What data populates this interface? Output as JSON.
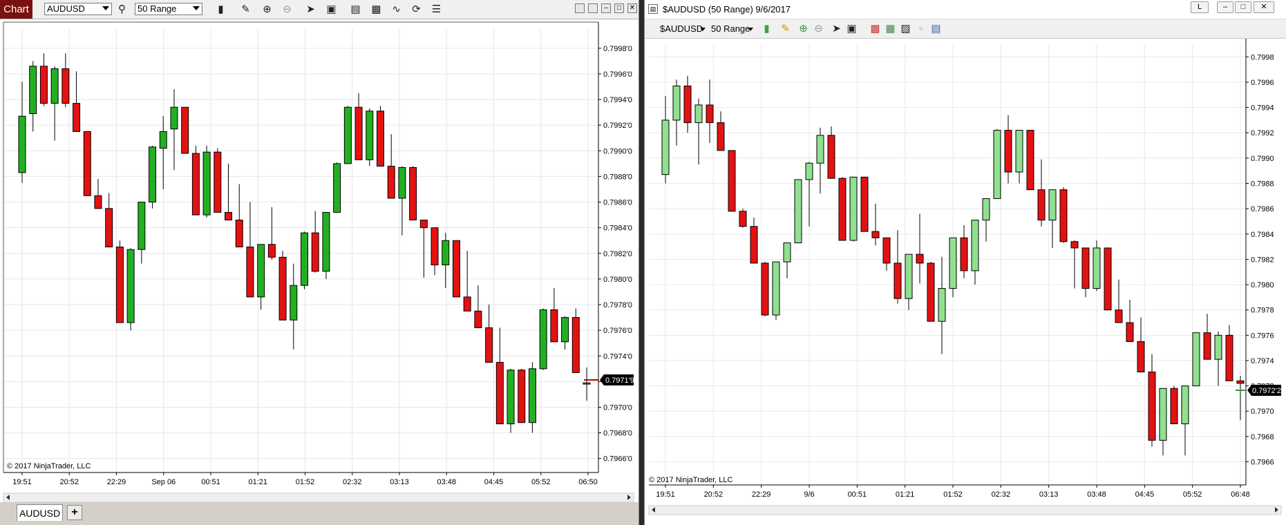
{
  "left": {
    "chart_tab": "Chart",
    "instrument": "AUDUSD",
    "interval": "50 Range",
    "copyright": "© 2017 NinjaTrader, LLC",
    "tab_label": "AUDUSD",
    "add_tab": "+",
    "price_marker": "0.7971'9",
    "y_ticks": [
      "0.7998'0",
      "0.7996'0",
      "0.7994'0",
      "0.7992'0",
      "0.7990'0",
      "0.7988'0",
      "0.7986'0",
      "0.7984'0",
      "0.7982'0",
      "0.7980'0",
      "0.7978'0",
      "0.7976'0",
      "0.7974'0",
      "0.7972'0",
      "0.7970'0",
      "0.7968'0",
      "0.7966'0"
    ],
    "x_ticks": [
      "19:51",
      "20:52",
      "22:29",
      "Sep 06",
      "00:51",
      "01:21",
      "01:52",
      "02:32",
      "03:13",
      "03:48",
      "04:45",
      "05:52",
      "06:50"
    ],
    "colors": {
      "up": "#22b022",
      "down": "#e31212",
      "grid": "#e6e6e6"
    }
  },
  "right": {
    "title": "$AUDUSD (50 Range)  9/6/2017",
    "window_button_l": "L",
    "instrument": "$AUDUSD",
    "interval": "50 Range",
    "copyright": "© 2017 NinjaTrader, LLC",
    "price_marker": "0.7972'2",
    "y_ticks": [
      "0.7998",
      "0.7996",
      "0.7994",
      "0.7992",
      "0.7990",
      "0.7988",
      "0.7986",
      "0.7984",
      "0.7982",
      "0.7980",
      "0.7978",
      "0.7976",
      "0.7974",
      "0.7972",
      "0.7970",
      "0.7968",
      "0.7966"
    ],
    "x_ticks": [
      "19:51",
      "20:52",
      "22:29",
      "9/6",
      "00:51",
      "01:21",
      "01:52",
      "02:32",
      "03:13",
      "03:48",
      "04:45",
      "05:52",
      "06:48"
    ],
    "colors": {
      "up": "#90e090",
      "down": "#e31212",
      "grid": "#e8e8e8"
    }
  },
  "chart_data": [
    {
      "type": "candlestick",
      "title": "AUDUSD",
      "xlabel": "",
      "ylabel": "",
      "ylim": [
        0.79655,
        0.79995
      ],
      "candles": [
        {
          "o": 0.79883,
          "h": 0.79954,
          "l": 0.79875,
          "c": 0.79927
        },
        {
          "o": 0.79929,
          "h": 0.7997,
          "l": 0.79915,
          "c": 0.79966
        },
        {
          "o": 0.79966,
          "h": 0.79976,
          "l": 0.79935,
          "c": 0.79937
        },
        {
          "o": 0.79937,
          "h": 0.79966,
          "l": 0.79908,
          "c": 0.79964
        },
        {
          "o": 0.79964,
          "h": 0.79976,
          "l": 0.79934,
          "c": 0.79937
        },
        {
          "o": 0.79937,
          "h": 0.79962,
          "l": 0.79915,
          "c": 0.79915
        },
        {
          "o": 0.79915,
          "h": 0.79915,
          "l": 0.79865,
          "c": 0.79865
        },
        {
          "o": 0.79865,
          "h": 0.79878,
          "l": 0.79855,
          "c": 0.79855
        },
        {
          "o": 0.79855,
          "h": 0.79867,
          "l": 0.79825,
          "c": 0.79825
        },
        {
          "o": 0.79825,
          "h": 0.7983,
          "l": 0.79766,
          "c": 0.79766
        },
        {
          "o": 0.79766,
          "h": 0.79824,
          "l": 0.7976,
          "c": 0.79823
        },
        {
          "o": 0.79823,
          "h": 0.7986,
          "l": 0.79812,
          "c": 0.7986
        },
        {
          "o": 0.7986,
          "h": 0.79904,
          "l": 0.79855,
          "c": 0.79903
        },
        {
          "o": 0.79902,
          "h": 0.79927,
          "l": 0.7987,
          "c": 0.79915
        },
        {
          "o": 0.79917,
          "h": 0.79948,
          "l": 0.79885,
          "c": 0.79934
        },
        {
          "o": 0.79934,
          "h": 0.79934,
          "l": 0.79898,
          "c": 0.79898
        },
        {
          "o": 0.79898,
          "h": 0.79904,
          "l": 0.7985,
          "c": 0.7985
        },
        {
          "o": 0.7985,
          "h": 0.79904,
          "l": 0.79848,
          "c": 0.79899
        },
        {
          "o": 0.79899,
          "h": 0.79902,
          "l": 0.79852,
          "c": 0.79852
        },
        {
          "o": 0.79852,
          "h": 0.7989,
          "l": 0.79846,
          "c": 0.79846
        },
        {
          "o": 0.79846,
          "h": 0.79874,
          "l": 0.79825,
          "c": 0.79825
        },
        {
          "o": 0.79825,
          "h": 0.7986,
          "l": 0.79786,
          "c": 0.79786
        },
        {
          "o": 0.79786,
          "h": 0.79827,
          "l": 0.79776,
          "c": 0.79827
        },
        {
          "o": 0.79827,
          "h": 0.79856,
          "l": 0.79815,
          "c": 0.79817
        },
        {
          "o": 0.79817,
          "h": 0.79822,
          "l": 0.79768,
          "c": 0.79768
        },
        {
          "o": 0.79768,
          "h": 0.79812,
          "l": 0.79745,
          "c": 0.79795
        },
        {
          "o": 0.79795,
          "h": 0.79837,
          "l": 0.79792,
          "c": 0.79836
        },
        {
          "o": 0.79836,
          "h": 0.79853,
          "l": 0.79805,
          "c": 0.79806
        },
        {
          "o": 0.79806,
          "h": 0.79852,
          "l": 0.798,
          "c": 0.79852
        },
        {
          "o": 0.79852,
          "h": 0.79891,
          "l": 0.79852,
          "c": 0.7989
        },
        {
          "o": 0.7989,
          "h": 0.79935,
          "l": 0.7989,
          "c": 0.79934
        },
        {
          "o": 0.79934,
          "h": 0.79945,
          "l": 0.79893,
          "c": 0.79893
        },
        {
          "o": 0.79893,
          "h": 0.79933,
          "l": 0.79888,
          "c": 0.79931
        },
        {
          "o": 0.79931,
          "h": 0.79935,
          "l": 0.79888,
          "c": 0.79888
        },
        {
          "o": 0.79888,
          "h": 0.79913,
          "l": 0.79863,
          "c": 0.79863
        },
        {
          "o": 0.79863,
          "h": 0.79888,
          "l": 0.79834,
          "c": 0.79887
        },
        {
          "o": 0.79887,
          "h": 0.79888,
          "l": 0.79846,
          "c": 0.79846
        },
        {
          "o": 0.79846,
          "h": 0.79846,
          "l": 0.79801,
          "c": 0.7984
        },
        {
          "o": 0.7984,
          "h": 0.7984,
          "l": 0.79803,
          "c": 0.79811
        },
        {
          "o": 0.79811,
          "h": 0.79836,
          "l": 0.79793,
          "c": 0.7983
        },
        {
          "o": 0.7983,
          "h": 0.7983,
          "l": 0.79786,
          "c": 0.79786
        },
        {
          "o": 0.79786,
          "h": 0.79822,
          "l": 0.79775,
          "c": 0.79775
        },
        {
          "o": 0.79775,
          "h": 0.79795,
          "l": 0.79762,
          "c": 0.79762
        },
        {
          "o": 0.79762,
          "h": 0.7978,
          "l": 0.79735,
          "c": 0.79735
        },
        {
          "o": 0.79735,
          "h": 0.79762,
          "l": 0.79687,
          "c": 0.79687
        },
        {
          "o": 0.79687,
          "h": 0.7973,
          "l": 0.7968,
          "c": 0.79729
        },
        {
          "o": 0.79729,
          "h": 0.7973,
          "l": 0.79688,
          "c": 0.79688
        },
        {
          "o": 0.79688,
          "h": 0.79735,
          "l": 0.7968,
          "c": 0.7973
        },
        {
          "o": 0.7973,
          "h": 0.79777,
          "l": 0.79729,
          "c": 0.79776
        },
        {
          "o": 0.79776,
          "h": 0.79793,
          "l": 0.79751,
          "c": 0.79751
        },
        {
          "o": 0.79751,
          "h": 0.79771,
          "l": 0.79745,
          "c": 0.7977
        },
        {
          "o": 0.7977,
          "h": 0.79777,
          "l": 0.79727,
          "c": 0.79727
        },
        {
          "o": 0.79718,
          "h": 0.79731,
          "l": 0.79705,
          "c": 0.79719
        }
      ]
    },
    {
      "type": "candlestick",
      "title": "$AUDUSD (50 Range)  9/6/2017",
      "xlabel": "",
      "ylabel": "",
      "ylim": [
        0.79645,
        0.7999
      ],
      "candles": [
        {
          "o": 0.79887,
          "h": 0.79949,
          "l": 0.7988,
          "c": 0.7993
        },
        {
          "o": 0.7993,
          "h": 0.79962,
          "l": 0.7991,
          "c": 0.79957
        },
        {
          "o": 0.79957,
          "h": 0.79965,
          "l": 0.7992,
          "c": 0.79928
        },
        {
          "o": 0.79928,
          "h": 0.79947,
          "l": 0.79895,
          "c": 0.79942
        },
        {
          "o": 0.79942,
          "h": 0.79962,
          "l": 0.79912,
          "c": 0.79928
        },
        {
          "o": 0.79928,
          "h": 0.79937,
          "l": 0.79906,
          "c": 0.79906
        },
        {
          "o": 0.79906,
          "h": 0.79906,
          "l": 0.79858,
          "c": 0.79858
        },
        {
          "o": 0.79858,
          "h": 0.7986,
          "l": 0.79845,
          "c": 0.79846
        },
        {
          "o": 0.79846,
          "h": 0.79853,
          "l": 0.79817,
          "c": 0.79817
        },
        {
          "o": 0.79817,
          "h": 0.79818,
          "l": 0.79775,
          "c": 0.79776
        },
        {
          "o": 0.79776,
          "h": 0.79818,
          "l": 0.79772,
          "c": 0.79818
        },
        {
          "o": 0.79818,
          "h": 0.79833,
          "l": 0.79805,
          "c": 0.79833
        },
        {
          "o": 0.79833,
          "h": 0.79883,
          "l": 0.79833,
          "c": 0.79883
        },
        {
          "o": 0.79883,
          "h": 0.79897,
          "l": 0.79846,
          "c": 0.79896
        },
        {
          "o": 0.79896,
          "h": 0.79924,
          "l": 0.79872,
          "c": 0.79918
        },
        {
          "o": 0.79918,
          "h": 0.79925,
          "l": 0.79884,
          "c": 0.79884
        },
        {
          "o": 0.79884,
          "h": 0.79885,
          "l": 0.79835,
          "c": 0.79835
        },
        {
          "o": 0.79835,
          "h": 0.79885,
          "l": 0.79834,
          "c": 0.79885
        },
        {
          "o": 0.79885,
          "h": 0.79882,
          "l": 0.79842,
          "c": 0.79842
        },
        {
          "o": 0.79842,
          "h": 0.79864,
          "l": 0.79831,
          "c": 0.79837
        },
        {
          "o": 0.79837,
          "h": 0.79837,
          "l": 0.79811,
          "c": 0.79817
        },
        {
          "o": 0.79817,
          "h": 0.79843,
          "l": 0.79785,
          "c": 0.79789
        },
        {
          "o": 0.79789,
          "h": 0.79824,
          "l": 0.7978,
          "c": 0.79824
        },
        {
          "o": 0.79824,
          "h": 0.79856,
          "l": 0.79801,
          "c": 0.79817
        },
        {
          "o": 0.79817,
          "h": 0.79818,
          "l": 0.79771,
          "c": 0.79771
        },
        {
          "o": 0.79771,
          "h": 0.79822,
          "l": 0.79745,
          "c": 0.79797
        },
        {
          "o": 0.79797,
          "h": 0.79837,
          "l": 0.7979,
          "c": 0.79837
        },
        {
          "o": 0.79837,
          "h": 0.79847,
          "l": 0.79805,
          "c": 0.79811
        },
        {
          "o": 0.79811,
          "h": 0.79851,
          "l": 0.798,
          "c": 0.79851
        },
        {
          "o": 0.79851,
          "h": 0.79868,
          "l": 0.79834,
          "c": 0.79868
        },
        {
          "o": 0.79868,
          "h": 0.79923,
          "l": 0.79868,
          "c": 0.79922
        },
        {
          "o": 0.79922,
          "h": 0.79934,
          "l": 0.7988,
          "c": 0.79889
        },
        {
          "o": 0.79889,
          "h": 0.79922,
          "l": 0.7988,
          "c": 0.79922
        },
        {
          "o": 0.79922,
          "h": 0.79922,
          "l": 0.79875,
          "c": 0.79875
        },
        {
          "o": 0.79875,
          "h": 0.79899,
          "l": 0.79846,
          "c": 0.79851
        },
        {
          "o": 0.79851,
          "h": 0.79875,
          "l": 0.79829,
          "c": 0.79875
        },
        {
          "o": 0.79875,
          "h": 0.79877,
          "l": 0.79833,
          "c": 0.79834
        },
        {
          "o": 0.79834,
          "h": 0.79835,
          "l": 0.79797,
          "c": 0.79829
        },
        {
          "o": 0.79829,
          "h": 0.79829,
          "l": 0.7979,
          "c": 0.79797
        },
        {
          "o": 0.79797,
          "h": 0.79835,
          "l": 0.79795,
          "c": 0.79829
        },
        {
          "o": 0.79829,
          "h": 0.79829,
          "l": 0.7978,
          "c": 0.7978
        },
        {
          "o": 0.7978,
          "h": 0.79804,
          "l": 0.7977,
          "c": 0.7977
        },
        {
          "o": 0.7977,
          "h": 0.79788,
          "l": 0.79755,
          "c": 0.79755
        },
        {
          "o": 0.79755,
          "h": 0.79774,
          "l": 0.79731,
          "c": 0.79731
        },
        {
          "o": 0.79731,
          "h": 0.79745,
          "l": 0.79672,
          "c": 0.79677
        },
        {
          "o": 0.79677,
          "h": 0.79718,
          "l": 0.79665,
          "c": 0.79718
        },
        {
          "o": 0.79718,
          "h": 0.7972,
          "l": 0.7969,
          "c": 0.7969
        },
        {
          "o": 0.7969,
          "h": 0.7972,
          "l": 0.79665,
          "c": 0.7972
        },
        {
          "o": 0.7972,
          "h": 0.79762,
          "l": 0.7972,
          "c": 0.79762
        },
        {
          "o": 0.79762,
          "h": 0.79777,
          "l": 0.79741,
          "c": 0.79741
        },
        {
          "o": 0.79741,
          "h": 0.79763,
          "l": 0.7972,
          "c": 0.7976
        },
        {
          "o": 0.7976,
          "h": 0.79768,
          "l": 0.79724,
          "c": 0.79724
        },
        {
          "o": 0.79724,
          "h": 0.79728,
          "l": 0.79693,
          "c": 0.79722
        }
      ]
    }
  ]
}
